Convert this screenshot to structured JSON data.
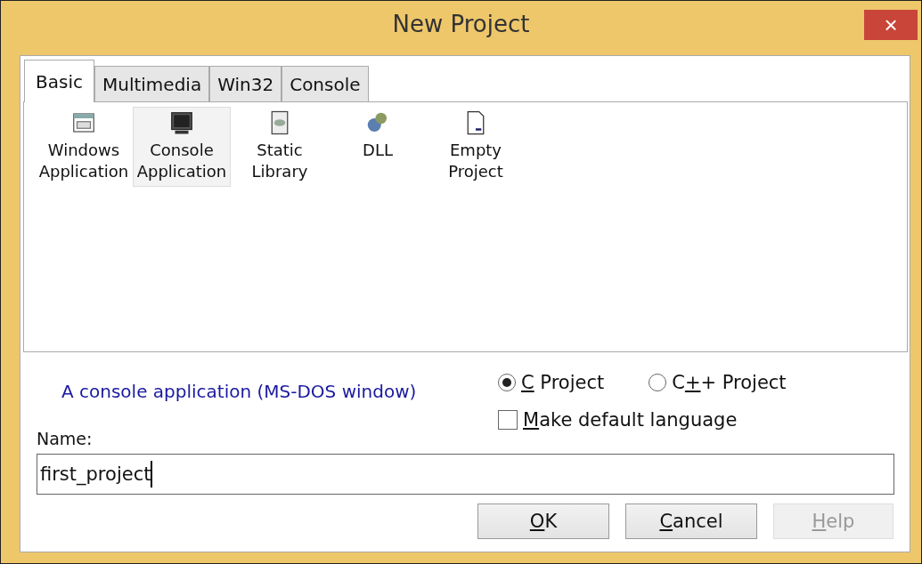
{
  "window": {
    "title": "New Project",
    "close": "×"
  },
  "tabs": [
    {
      "label": "Basic",
      "selected": true
    },
    {
      "label": "Multimedia",
      "selected": false
    },
    {
      "label": "Win32",
      "selected": false
    },
    {
      "label": "Console",
      "selected": false
    }
  ],
  "templates": [
    {
      "lines": [
        "Windows",
        "Application"
      ],
      "selected": false
    },
    {
      "lines": [
        "Console",
        "Application"
      ],
      "selected": true
    },
    {
      "lines": [
        "Static",
        "Library"
      ],
      "selected": false
    },
    {
      "lines": [
        "DLL"
      ],
      "selected": false
    },
    {
      "lines": [
        "Empty",
        "Project"
      ],
      "selected": false
    }
  ],
  "description": "A console application (MS-DOS window)",
  "languages": [
    {
      "key": "C",
      "after": " Project",
      "selected": true
    },
    {
      "before": "C",
      "key": "+",
      "after": "+ Project",
      "selected": false
    }
  ],
  "default_language": {
    "key": "M",
    "after": "ake default language",
    "checked": false
  },
  "name": {
    "label": "Name:",
    "value": "first_project"
  },
  "buttons": [
    {
      "key": "O",
      "after": "K",
      "disabled": false
    },
    {
      "key": "C",
      "after": "ancel",
      "disabled": false
    },
    {
      "key": "H",
      "after": "elp",
      "disabled": true
    }
  ]
}
